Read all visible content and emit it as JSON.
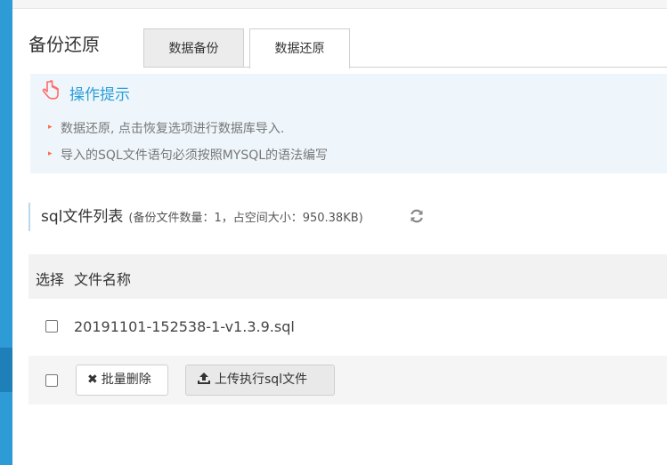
{
  "page": {
    "title": "备份还原"
  },
  "tabs": [
    {
      "label": "数据备份"
    },
    {
      "label": "数据还原"
    }
  ],
  "tips": {
    "icon": "pointing-hand-icon",
    "title": "操作提示",
    "items": [
      "数据还原, 点击恢复选项进行数据库导入.",
      "导入的SQL文件语句必须按照MYSQL的语法编写"
    ]
  },
  "section": {
    "title": "sql文件列表",
    "subtitle": "(备份文件数量：1，占空间大小：950.38KB)",
    "refresh_icon": "refresh-icon"
  },
  "table": {
    "columns": [
      "选择",
      "文件名称"
    ],
    "rows": [
      {
        "filename": "20191101-152538-1-v1.3.9.sql"
      }
    ]
  },
  "actions": {
    "batch_delete": "批量删除",
    "upload_execute": "上传执行sql文件"
  },
  "colors": {
    "accent": "#2b9ed8",
    "sidebar": "#2e9ad6",
    "tip_bullet": "#ff6a4a"
  }
}
